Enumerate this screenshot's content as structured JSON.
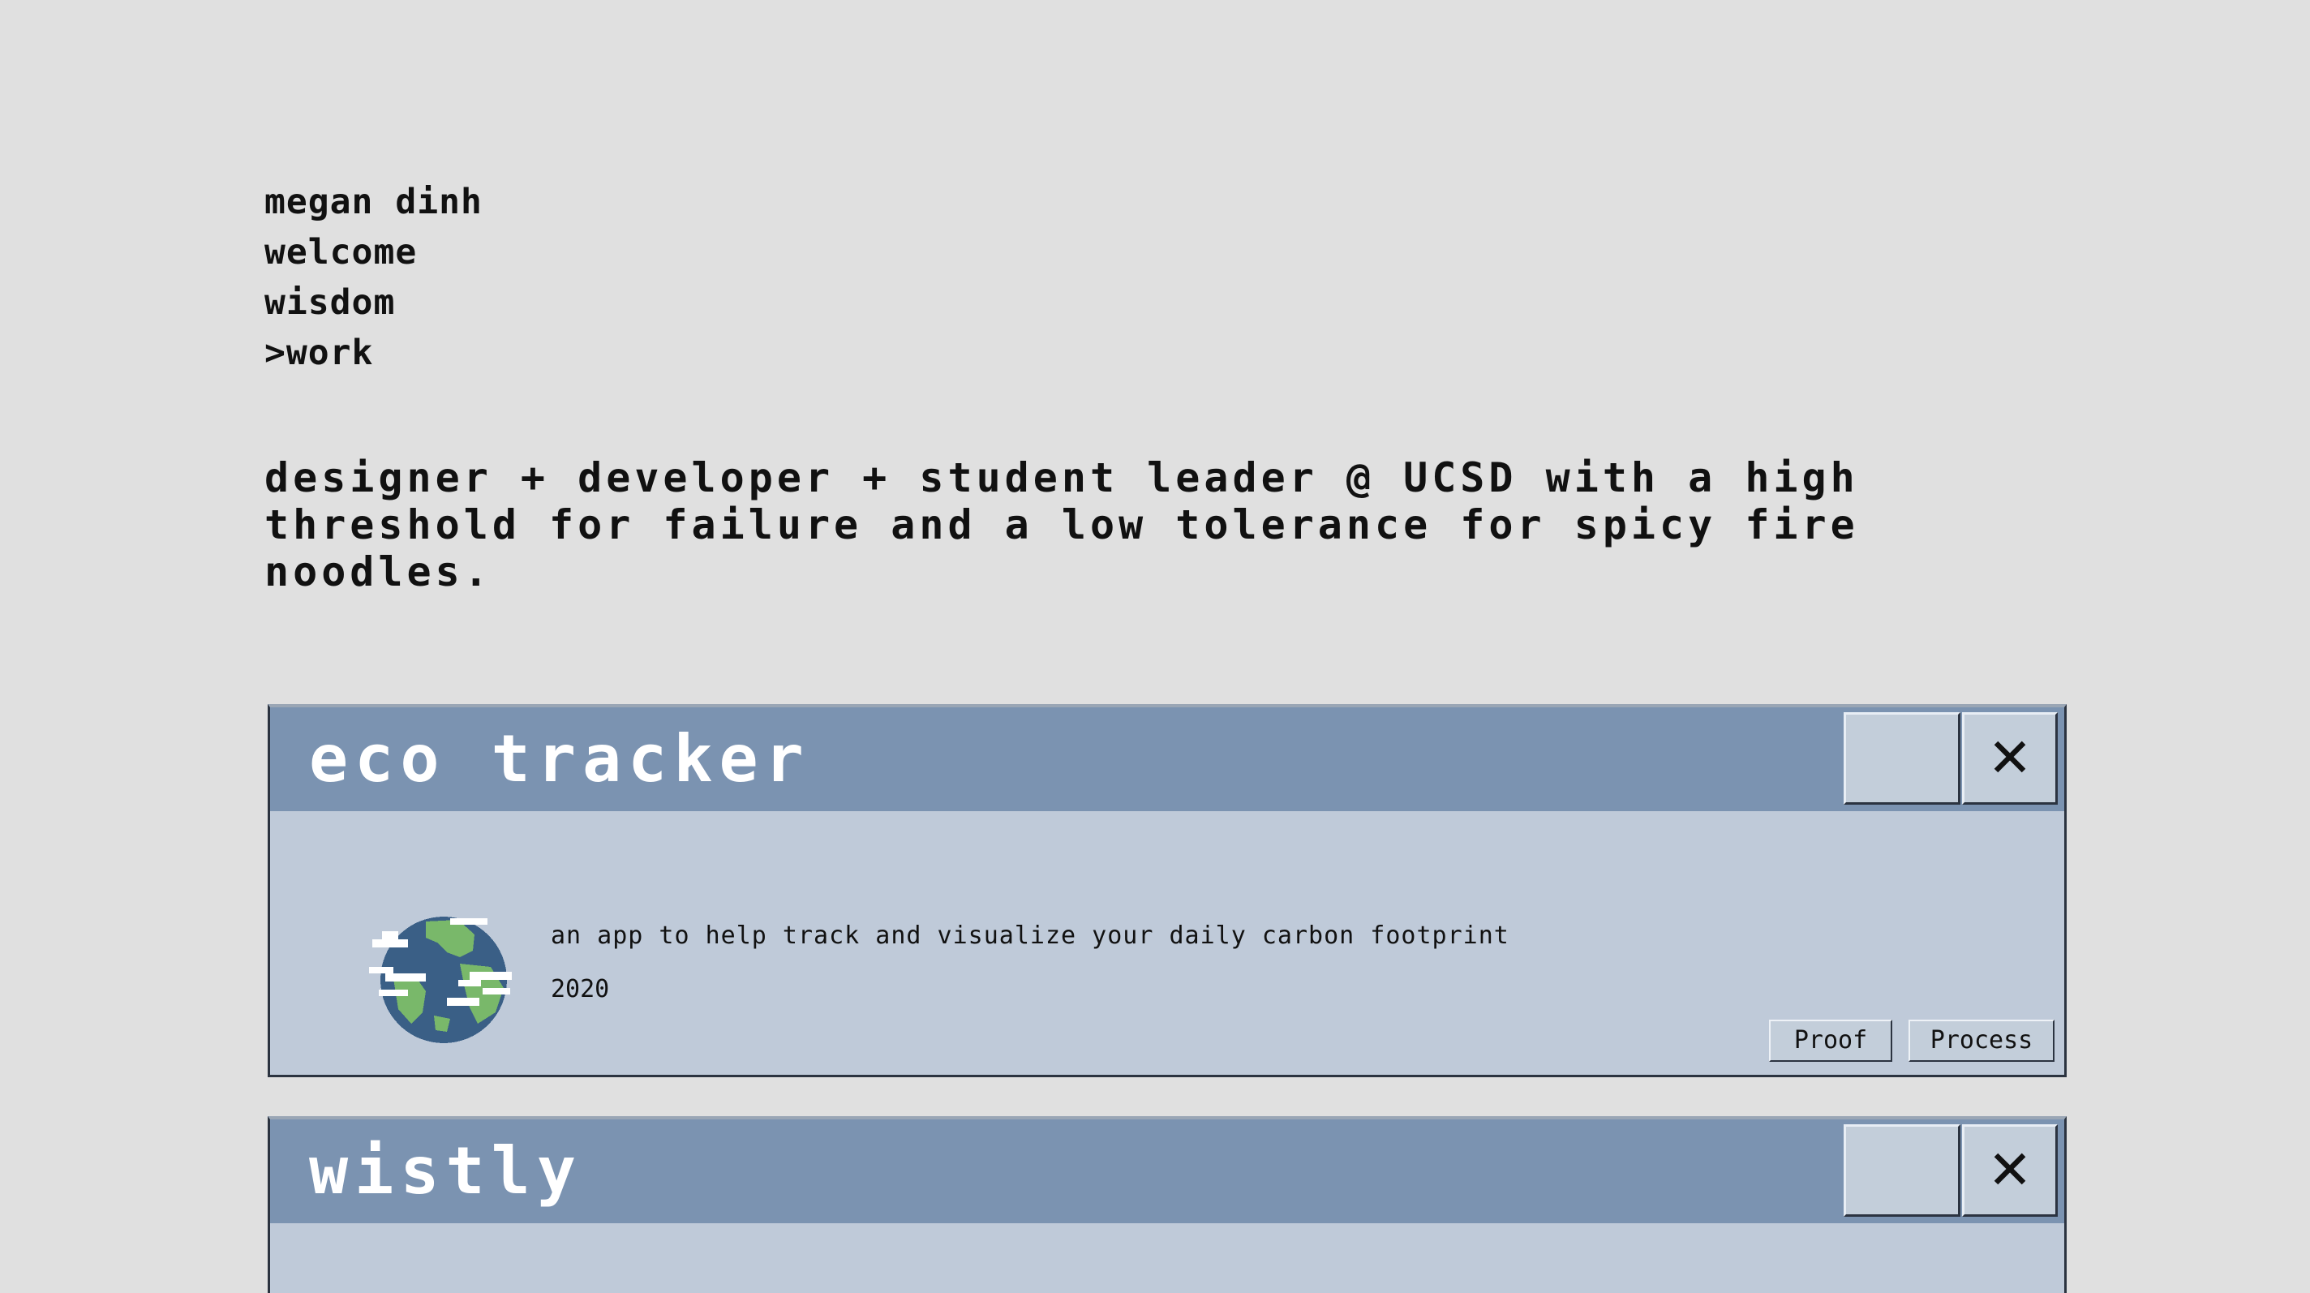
{
  "nav": {
    "items": [
      {
        "label": "megan dinh"
      },
      {
        "label": "welcome"
      },
      {
        "label": "wisdom"
      },
      {
        "label": ">work"
      }
    ]
  },
  "bio": "designer + developer + student leader @ UCSD with a high threshold for failure and a low tolerance for spicy fire noodles.",
  "projects": [
    {
      "title": "eco tracker",
      "description": "an app to help track and visualize your daily carbon footprint",
      "year": "2020",
      "icon": "globe-icon",
      "buttons": {
        "proof": "Proof",
        "process": "Process"
      },
      "close_glyph": "✕"
    },
    {
      "title": "wistly",
      "close_glyph": "✕"
    }
  ],
  "colors": {
    "background": "#e0e0e0",
    "titlebar": "#7b93b1",
    "window_body": "#bfcad9",
    "text": "#111111"
  }
}
